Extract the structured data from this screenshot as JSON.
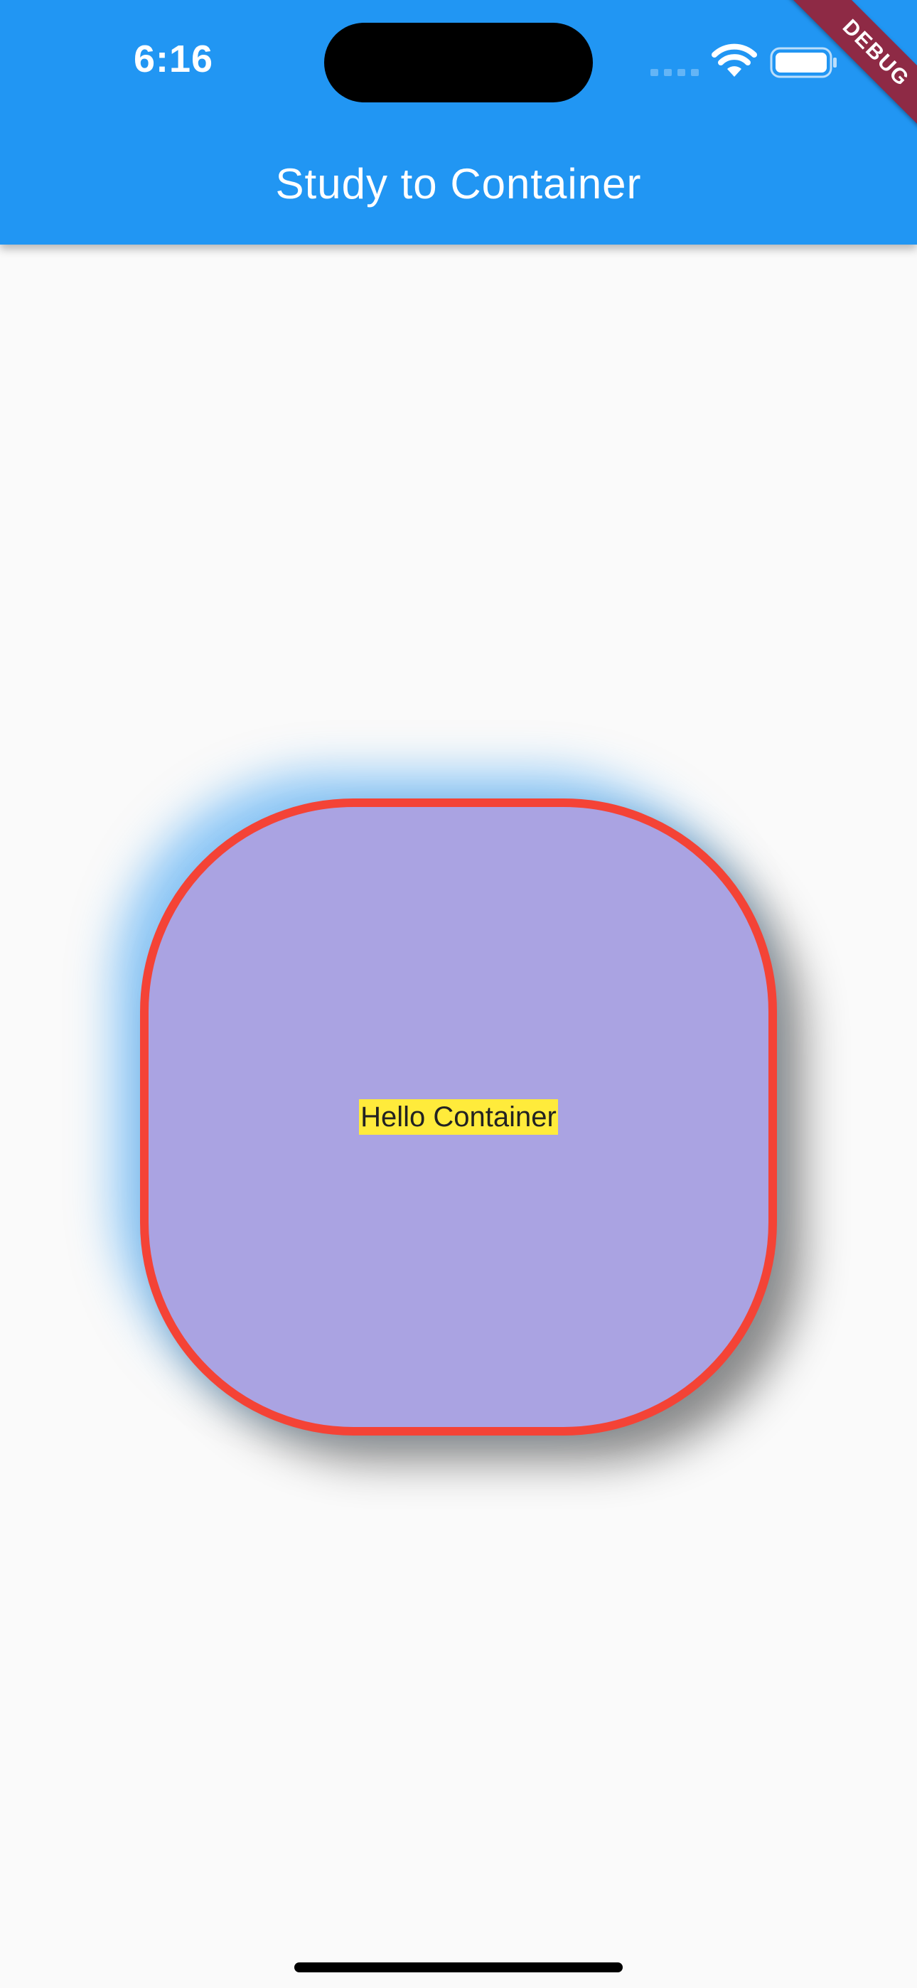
{
  "status_bar": {
    "time": "6:16",
    "icons": [
      "signal-icon",
      "wifi-icon",
      "battery-icon"
    ]
  },
  "app_bar": {
    "title": "Study to Container",
    "color": "#2196f3"
  },
  "debug_banner": {
    "label": "DEBUG",
    "color": "#8e2a45"
  },
  "container": {
    "text": "Hello Container",
    "fill_color": "#aaa3e2",
    "border_color": "#f44336",
    "text_background": "#ffeb3b"
  }
}
